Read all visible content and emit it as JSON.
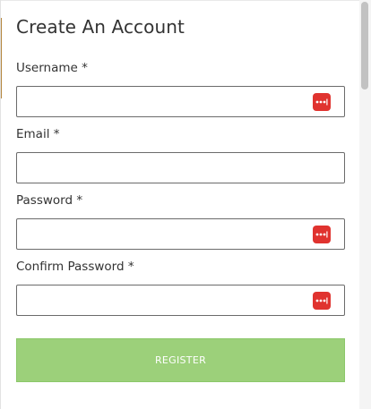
{
  "form": {
    "title": "Create An Account",
    "username": {
      "label": "Username *",
      "value": "",
      "placeholder": ""
    },
    "email": {
      "label": "Email *",
      "value": "",
      "placeholder": ""
    },
    "password": {
      "label": "Password *",
      "value": "",
      "placeholder": ""
    },
    "confirm_password": {
      "label": "Confirm Password *",
      "value": "",
      "placeholder": ""
    },
    "register_label": "REGISTER"
  },
  "icons": {
    "password_manager": "password-manager-icon"
  },
  "colors": {
    "register_button": "#9cd07a",
    "icon_accent": "#e0332f",
    "border": "#6b6b6b",
    "text": "#333333"
  }
}
